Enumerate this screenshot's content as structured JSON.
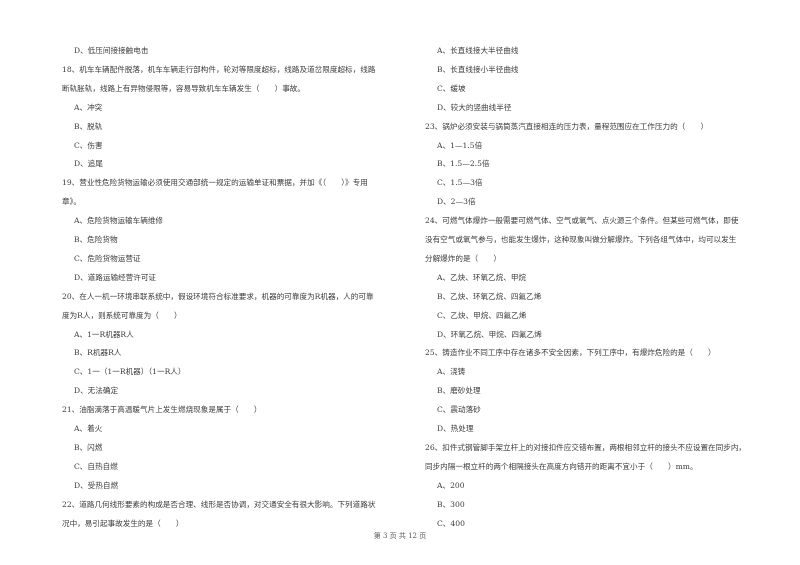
{
  "left_column": [
    {
      "type": "option",
      "text": "D、低压间接接触电击"
    },
    {
      "type": "question",
      "text": "18、机车车辆配件脱落，机车车辆走行部构件，轮对等限度超标，线路及道岔限度超标，线路"
    },
    {
      "type": "question",
      "text": "断轨胀轨，线路上有异物侵限等，容易导致机车车辆发生（　　）事故。"
    },
    {
      "type": "option",
      "text": "A、冲突"
    },
    {
      "type": "option",
      "text": "B、脱轨"
    },
    {
      "type": "option",
      "text": "C、伤害"
    },
    {
      "type": "option",
      "text": "D、追尾"
    },
    {
      "type": "question",
      "text": "19、营业性危险货物运输必须使用交通部统一规定的运输单证和票据，并加《（　　）》专用"
    },
    {
      "type": "question",
      "text": "章》。"
    },
    {
      "type": "option",
      "text": "A、危险货物运输车辆维修"
    },
    {
      "type": "option",
      "text": "B、危险货物"
    },
    {
      "type": "option",
      "text": "C、危险货物运营证"
    },
    {
      "type": "option",
      "text": "D、道路运输经营许可证"
    },
    {
      "type": "question",
      "text": "20、在人一机一环境串联系统中，假设环境符合标准要求，机器的可靠度为R机器，人的可靠"
    },
    {
      "type": "question",
      "text": "度为R人，则系统可靠度为（　　）"
    },
    {
      "type": "option",
      "text": "A、1一R机器R人"
    },
    {
      "type": "option",
      "text": "B、R机器R人"
    },
    {
      "type": "option",
      "text": "C、1一（1一R机器）（1一R人）"
    },
    {
      "type": "option",
      "text": "D、无法确定"
    },
    {
      "type": "question",
      "text": "21、油脂滴落于高温暖气片上发生燃烧现象是属于（　　）"
    },
    {
      "type": "option",
      "text": "A、着火"
    },
    {
      "type": "option",
      "text": "B、闪燃"
    },
    {
      "type": "option",
      "text": "C、自热自燃"
    },
    {
      "type": "option",
      "text": "D、受热自燃"
    },
    {
      "type": "question",
      "text": "22、道路几何线形要素的构成是否合理、线形是否协调，对交通安全有很大影响。下列道路状"
    },
    {
      "type": "question",
      "text": "况中，易引起事故发生的是（　　）"
    }
  ],
  "right_column": [
    {
      "type": "option",
      "text": "A、长直线接大半径曲线"
    },
    {
      "type": "option",
      "text": "B、长直线接小半径曲线"
    },
    {
      "type": "option",
      "text": "C、缓坡"
    },
    {
      "type": "option",
      "text": "D、较大的竖曲线半径"
    },
    {
      "type": "question",
      "text": "23、锅炉必须安装与锅筒蒸汽直接相连的压力表，量程范围应在工作压力的（　　）"
    },
    {
      "type": "option",
      "text": "A、1—1.5倍"
    },
    {
      "type": "option",
      "text": "B、1.5—2.5倍"
    },
    {
      "type": "option",
      "text": "C、1.5—3倍"
    },
    {
      "type": "option",
      "text": "D、2—3倍"
    },
    {
      "type": "question",
      "text": "24、可燃气体爆炸一般需要可燃气体、空气或氧气、点火源三个条件。但某些可燃气体，即使"
    },
    {
      "type": "question",
      "text": "没有空气或氧气参与，也能发生爆炸，这种现象叫做分解爆炸。下列各组气体中，均可以发生"
    },
    {
      "type": "question",
      "text": "分解爆炸的是（　　）"
    },
    {
      "type": "option",
      "text": "A、乙炔、环氧乙烷、甲烷"
    },
    {
      "type": "option",
      "text": "B、乙炔、环氧乙烷、四氟乙烯"
    },
    {
      "type": "option",
      "text": "C、乙炔、甲烷、四氟乙烯"
    },
    {
      "type": "option",
      "text": "D、环氧乙烷、甲烷、四氟乙烯"
    },
    {
      "type": "question",
      "text": "25、铸造作业不同工序中存在诸多不安全因素，下列工序中，有爆炸危险的是（　　）"
    },
    {
      "type": "option",
      "text": "A、浇铸"
    },
    {
      "type": "option",
      "text": "B、磨砂处理"
    },
    {
      "type": "option",
      "text": "C、震动落砂"
    },
    {
      "type": "option",
      "text": "D、热处理"
    },
    {
      "type": "question",
      "text": "26、扣件式钢管脚手架立杆上的对接扣件应交错布置，两根相邻立杆的接头不应设置在同步内，"
    },
    {
      "type": "question",
      "text": "同步内隔一根立杆的两个相隔接头在高度方向错开的距离不宜小于（　　）mm。"
    },
    {
      "type": "option",
      "text": "A、200"
    },
    {
      "type": "option",
      "text": "B、300"
    },
    {
      "type": "option",
      "text": "C、400"
    }
  ],
  "footer": {
    "page_label": "第 3 页 共 12 页"
  }
}
